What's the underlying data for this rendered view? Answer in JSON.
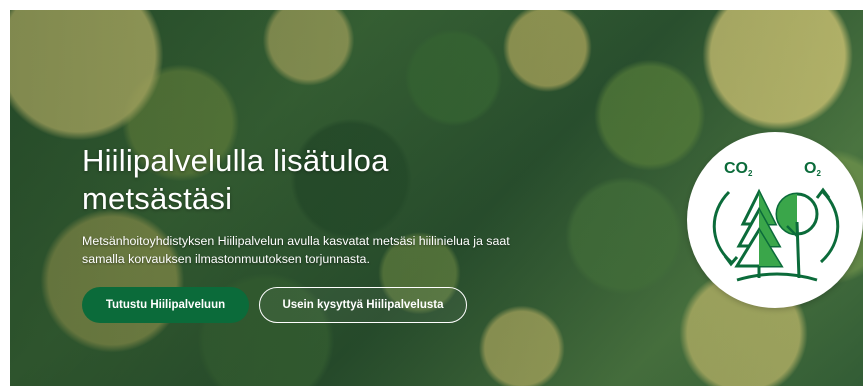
{
  "hero": {
    "title_line1": "Hiilipalvelulla lisätuloa",
    "title_line2": "metsästäsi",
    "description": "Metsänhoitoyhdistyksen Hiilipalvelun avulla kasvatat metsäsi hiilinielua ja saat samalla korvauksen ilmastonmuutoksen torjunnasta.",
    "primary_button": "Tutustu Hiilipalveluun",
    "secondary_button": "Usein kysyttyä Hiilipalvelusta",
    "background_image": "aerial-forest-photo"
  },
  "badge": {
    "co_label": "CO",
    "co_sub": "2",
    "o_label": "O",
    "o_sub": "2",
    "icon": "carbon-cycle-trees-icon"
  },
  "colors": {
    "brand_green": "#0b6b3a",
    "white": "#ffffff"
  }
}
